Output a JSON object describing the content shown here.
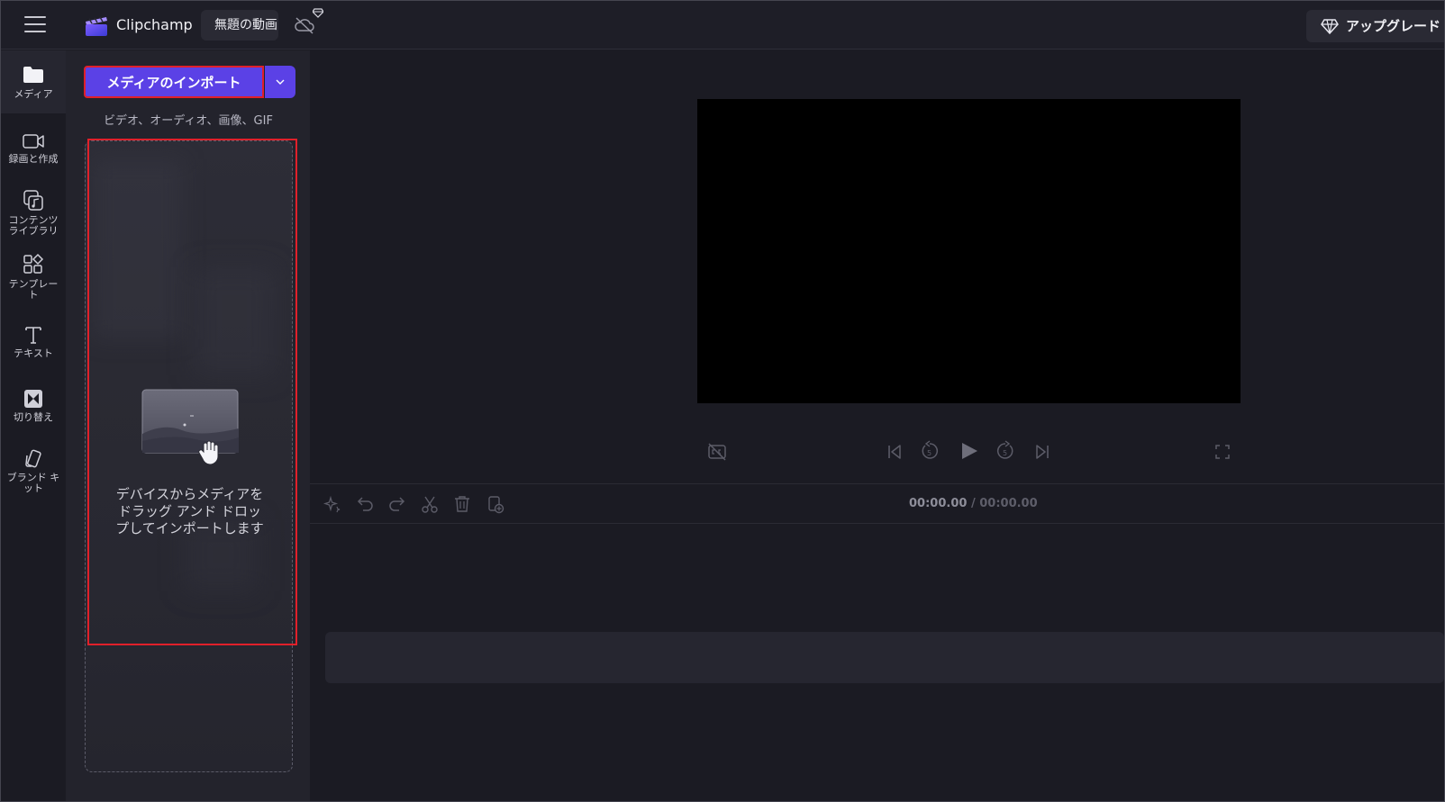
{
  "header": {
    "app_name": "Clipchamp",
    "project_title": "無題の動画",
    "upgrade_label": "アップグレード"
  },
  "sidebar": {
    "items": [
      {
        "label": "メディア",
        "icon": "folder-icon",
        "active": true
      },
      {
        "label": "録画と作成",
        "icon": "camera-icon"
      },
      {
        "label": "コンテンツ\nライブラリ",
        "icon": "content-library-icon"
      },
      {
        "label": "テンプレー\nト",
        "icon": "templates-icon"
      },
      {
        "label": "テキスト",
        "icon": "text-icon"
      },
      {
        "label": "切り替え",
        "icon": "transitions-icon"
      },
      {
        "label": "ブランド キ\nット",
        "icon": "brand-kit-icon"
      }
    ]
  },
  "media_panel": {
    "import_label": "メディアのインポート",
    "import_types": "ビデオ、オーディオ、画像、GIF",
    "dropzone_text": "デバイスからメディアを\nドラッグ アンド ドロッ\nプしてインポートします"
  },
  "timeline": {
    "current_time": "00:00.00",
    "separator": " / ",
    "total_time": "00:00.00"
  },
  "colors": {
    "accent": "#5b41e6",
    "highlight": "#e0202a",
    "background": "#1b1b23",
    "panel": "#23232c"
  }
}
